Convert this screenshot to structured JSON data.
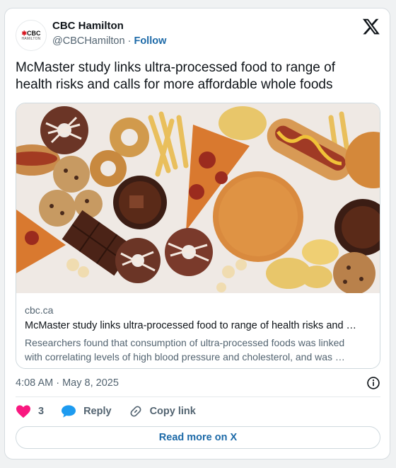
{
  "account": {
    "name": "CBC Hamilton",
    "handle": "@CBCHamilton",
    "separator": "·",
    "follow_label": "Follow",
    "avatar_text": "CBC",
    "avatar_subtext": "HAMILTON"
  },
  "tweet": {
    "text": "McMaster study links ultra-processed food to range of health risks and calls for more affordable whole foods"
  },
  "link_card": {
    "domain": "cbc.ca",
    "title": "McMaster study links ultra-processed food to range of health risks and …",
    "description_line1": "Researchers found that consumption of ultra-processed foods was linked",
    "description_line2": "with correlating levels of high blood pressure and cholesterol, and was …"
  },
  "meta": {
    "timestamp": "4:08 AM · May 8, 2025"
  },
  "actions": {
    "like_count": "3",
    "reply_label": "Reply",
    "copy_link_label": "Copy link",
    "read_more_label": "Read more on X"
  },
  "colors": {
    "accent": "#1d6aa8",
    "like": "#f91880",
    "reply": "#1d9bf0",
    "brand_red": "#d7161f"
  },
  "icons": [
    "x-logo-icon",
    "info-icon",
    "heart-icon",
    "reply-bubble-icon",
    "link-icon"
  ]
}
